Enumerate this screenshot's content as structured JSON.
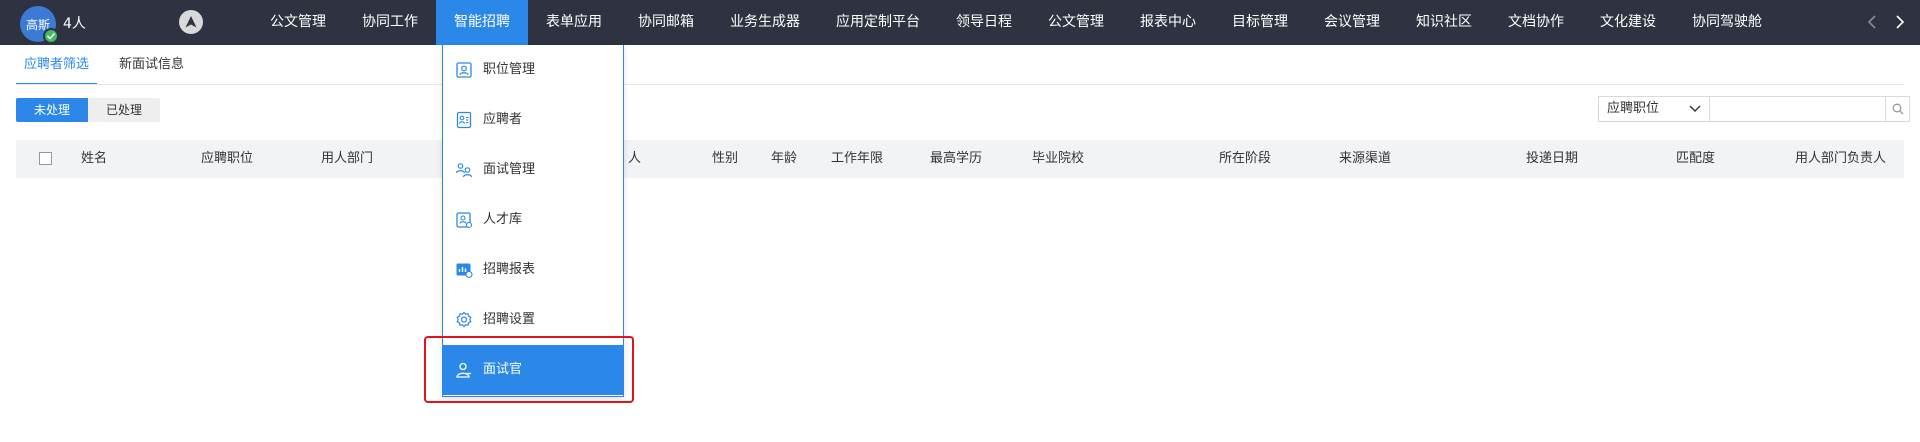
{
  "topbar": {
    "avatar_text": "高斯",
    "user_count": "4人",
    "nav_items": [
      "公文管理",
      "协同工作",
      "智能招聘",
      "表单应用",
      "协同邮箱",
      "业务生成器",
      "应用定制平台",
      "领导日程",
      "公文管理",
      "报表中心",
      "目标管理",
      "会议管理",
      "知识社区",
      "文档协作",
      "文化建设",
      "协同驾驶舱"
    ],
    "active_nav": "智能招聘",
    "colors": {
      "bar": "#2f3341",
      "active": "#2b88e8"
    }
  },
  "subtabs": [
    "应聘者筛选",
    "新面试信息"
  ],
  "status_toggle": [
    "未处理",
    "已处理"
  ],
  "filter": {
    "select_value": "应聘职位",
    "input_placeholder": "",
    "search_icon": "search-icon"
  },
  "table": {
    "columns": [
      "姓名",
      "应聘职位",
      "用人部门",
      "人",
      "性别",
      "年龄",
      "工作年限",
      "最高学历",
      "毕业院校",
      "所在阶段",
      "来源渠道",
      "投递日期",
      "匹配度",
      "用人部门负责人"
    ]
  },
  "dropdown": {
    "items": [
      {
        "label": "职位管理",
        "icon": "position-icon"
      },
      {
        "label": "应聘者",
        "icon": "applicant-icon"
      },
      {
        "label": "面试管理",
        "icon": "interview-icon"
      },
      {
        "label": "人才库",
        "icon": "talent-pool-icon"
      },
      {
        "label": "招聘报表",
        "icon": "report-icon"
      },
      {
        "label": "招聘设置",
        "icon": "gear-icon"
      },
      {
        "label": "面试官",
        "icon": "interviewer-icon"
      }
    ],
    "active_item": "面试官"
  },
  "highlight_color": "#e0141e"
}
